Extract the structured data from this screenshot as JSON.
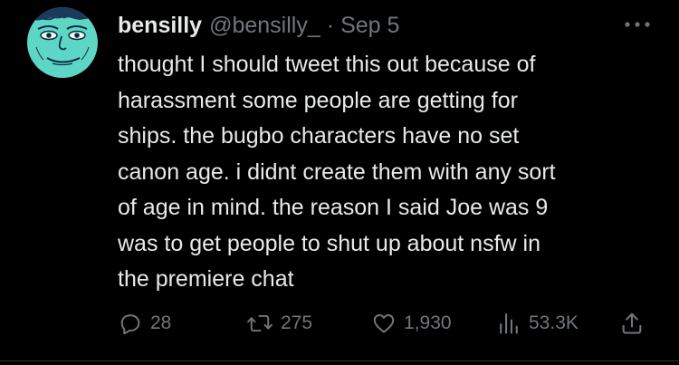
{
  "tweet": {
    "author": {
      "display_name": "bensilly",
      "handle": "@bensilly_",
      "separator": "·",
      "date": "Sep 5"
    },
    "text_lines": [
      "thought I should tweet this out because of",
      "harassment some people are getting for",
      "ships. the bugbo characters have no set",
      "canon age. i didnt create them with any sort",
      "of age in mind. the reason I said Joe was 9",
      "was to get people to shut up about nsfw in",
      "the premiere chat"
    ],
    "actions": {
      "replies": "28",
      "retweets": "275",
      "likes": "1,930",
      "views": "53.3K"
    },
    "icons": {
      "more": "more-horizontal-icon",
      "reply": "reply-bubble-icon",
      "retweet": "retweet-icon",
      "like": "heart-icon",
      "views": "views-bar-chart-icon",
      "share": "share-upload-icon"
    }
  },
  "colors": {
    "background": "#000000",
    "text": "#e7e9ea",
    "secondary": "#71767b",
    "avatar_skin": "#5ed6c6"
  }
}
